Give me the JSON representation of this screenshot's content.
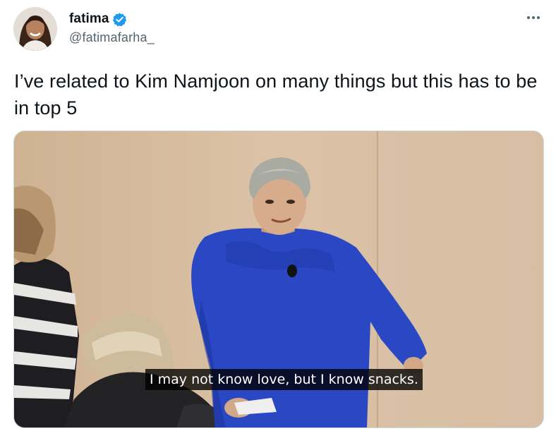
{
  "author": {
    "display_name": "fatima",
    "handle": "@fatimafarha_",
    "verified": true,
    "verified_color": "#1d9bf0"
  },
  "tweet": {
    "text": "I’ve related to Kim Namjoon on many things but this has to be in top 5"
  },
  "media": {
    "subtitle": "I may not know love, but I know snacks.",
    "sweater_color": "#2a47c4",
    "wall_color": "#d6bc9f"
  },
  "icons": {
    "more": "more-options-icon",
    "verified": "verified-badge-icon"
  }
}
